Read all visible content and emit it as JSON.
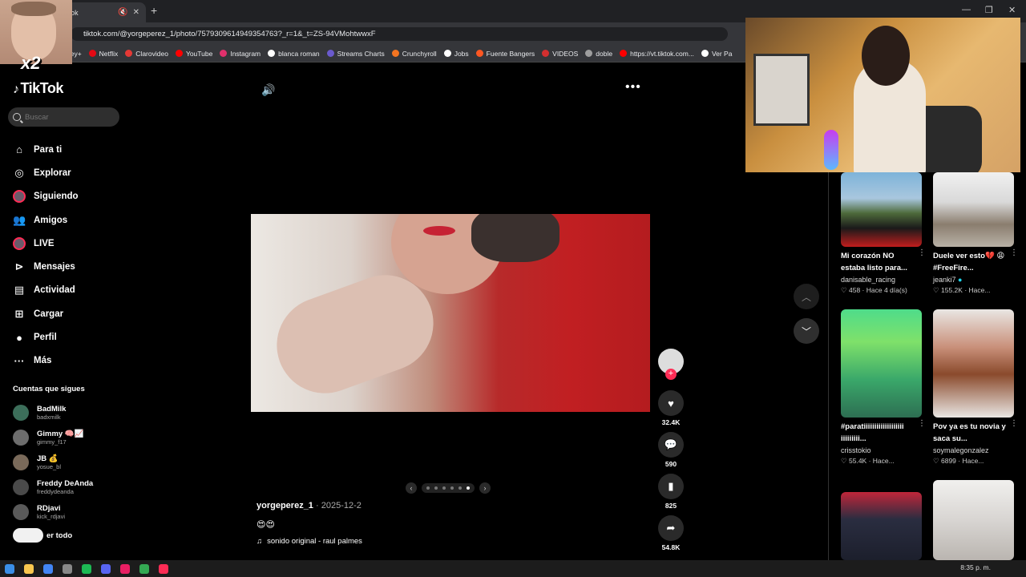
{
  "browser": {
    "tab_title": "TikTok",
    "url": "tiktok.com/@yorgeperez_1/photo/7579309614949354763?_r=1&_t=ZS-94VMohtwwxF",
    "bookmarks": [
      "ney+",
      "Netflix",
      "Clarovideo",
      "YouTube",
      "Instagram",
      "blanca roman",
      "Streams Charts",
      "Crunchyroll",
      "Jobs",
      "Fuente Bangers",
      "VIDEOS",
      "doble",
      "https://vt.tiktok.com...",
      "Ver Pa"
    ]
  },
  "sidebar": {
    "logo": "TikTok",
    "search_placeholder": "Buscar",
    "nav": [
      {
        "label": "Para ti",
        "icon": "home-icon"
      },
      {
        "label": "Explorar",
        "icon": "compass-icon"
      },
      {
        "label": "Siguiendo",
        "icon": "avatar-icon"
      },
      {
        "label": "Amigos",
        "icon": "friends-icon"
      },
      {
        "label": "LIVE",
        "icon": "live-icon"
      },
      {
        "label": "Mensajes",
        "icon": "messages-icon"
      },
      {
        "label": "Actividad",
        "icon": "activity-icon"
      },
      {
        "label": "Cargar",
        "icon": "upload-icon"
      },
      {
        "label": "Perfil",
        "icon": "profile-icon"
      },
      {
        "label": "Más",
        "icon": "more-icon"
      }
    ],
    "following_title": "Cuentas que sigues",
    "following": [
      {
        "name": "BadMilk",
        "handle": "badxmilk"
      },
      {
        "name": "Gimmy 🧠📈",
        "handle": "gimmy_f17"
      },
      {
        "name": "JB 💰",
        "handle": "yosue_bl"
      },
      {
        "name": "Freddy DeAnda",
        "handle": "freddydeanda"
      },
      {
        "name": "RDjavi",
        "handle": "kick_rdjavi"
      }
    ],
    "see_all": "er todo"
  },
  "post": {
    "author": "yorgeperez_1",
    "date": "2025-12-2",
    "separator": " · ",
    "caption": "😍😍",
    "music": "sonido original - raul palmes",
    "likes": "32.4K",
    "comments": "590",
    "saves": "825",
    "shares": "54.8K",
    "slides_total": 6,
    "slide_active": 6
  },
  "recommendations": [
    {
      "title": "Mi corazón NO estaba listo para...",
      "author": "danisable_racing",
      "likes": "458",
      "time": "Hace 4 día(s)",
      "verified": false
    },
    {
      "title": "Duele ver esto💔 😩 #FreeFire...",
      "author": "jeanki7",
      "likes": "155.2K",
      "time": "Hace...",
      "verified": true
    },
    {
      "title": "#paratiiiiiiiiiiiiiiiiiii iiiiiiiii...",
      "author": "crisstokio",
      "likes": "55.4K",
      "time": "Hace...",
      "verified": false
    },
    {
      "title": "Pov ya es tu novia y saca su...",
      "author": "soymalegonzalez",
      "likes": "6899",
      "time": "Hace...",
      "verified": false
    },
    {
      "title": "",
      "author": "",
      "likes": "",
      "time": "",
      "verified": false
    },
    {
      "title": "",
      "author": "",
      "likes": "",
      "time": "",
      "verified": false
    }
  ],
  "overlay": {
    "multiplier": "x2"
  },
  "taskbar": {
    "time": "8:35 p. m."
  },
  "colors": {
    "accent": "#fe2c55",
    "background": "#000000",
    "panel": "#2f2f2f"
  }
}
